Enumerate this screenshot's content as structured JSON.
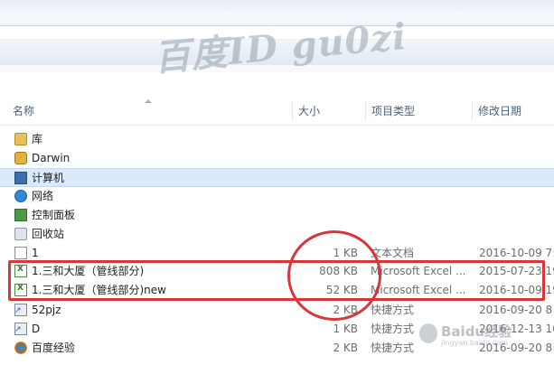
{
  "watermark": "百度ID gu0zi",
  "columns": {
    "name": "名称",
    "size": "大小",
    "type": "项目类型",
    "modified": "修改日期"
  },
  "rows": [
    {
      "name": "库",
      "size": "",
      "type": "",
      "date": "",
      "icon": "library-folder-icon"
    },
    {
      "name": "Darwin",
      "size": "",
      "type": "",
      "date": "",
      "icon": "user-folder-icon"
    },
    {
      "name": "计算机",
      "size": "",
      "type": "",
      "date": "",
      "icon": "computer-icon",
      "selected": true
    },
    {
      "name": "网络",
      "size": "",
      "type": "",
      "date": "",
      "icon": "network-icon"
    },
    {
      "name": "控制面板",
      "size": "",
      "type": "",
      "date": "",
      "icon": "control-panel-icon"
    },
    {
      "name": "回收站",
      "size": "",
      "type": "",
      "date": "",
      "icon": "recycle-bin-icon"
    },
    {
      "name": "1",
      "size": "1 KB",
      "type": "文本文档",
      "date": "2016-10-09 7:5",
      "icon": "text-file-icon"
    },
    {
      "name": "1.三和大厦（管线部分)",
      "size": "808 KB",
      "type": "Microsoft Excel ...",
      "date": "2015-07-23 19",
      "icon": "excel-file-icon"
    },
    {
      "name": "1.三和大厦（管线部分)new",
      "size": "52 KB",
      "type": "Microsoft Excel ...",
      "date": "2016-10-09 19",
      "icon": "excel-file-icon"
    },
    {
      "name": "52pjz",
      "size": "2 KB",
      "type": "快捷方式",
      "date": "2016-09-20 8",
      "icon": "shortcut-icon"
    },
    {
      "name": "D",
      "size": "1 KB",
      "type": "快捷方式",
      "date": "2016-12-13 10",
      "icon": "shortcut-icon"
    },
    {
      "name": "百度经验",
      "size": "2 KB",
      "type": "快捷方式",
      "date": "2016-09-20 8",
      "icon": "chrome-shortcut-icon"
    }
  ],
  "logo": {
    "text": "Baidu经验",
    "sub": "jingyan.baidu.com"
  },
  "colors": {
    "highlight": "#d9363a",
    "selection": "#dbe9fa",
    "header_text": "#4c607a"
  }
}
